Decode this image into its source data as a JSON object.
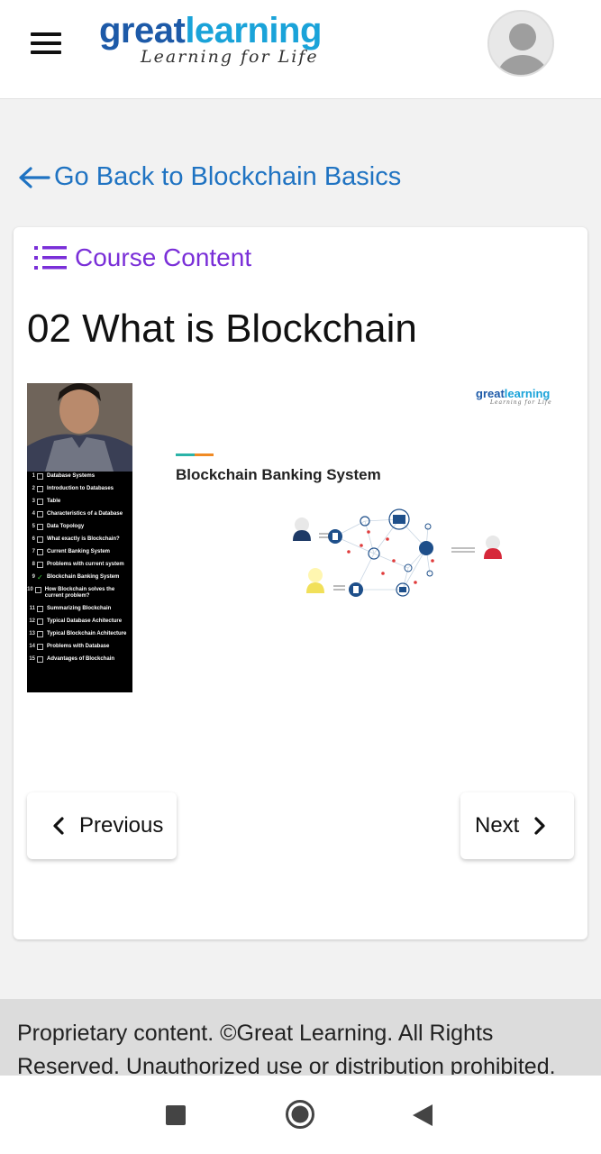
{
  "header": {
    "logo_part1": "great",
    "logo_part2": "learning",
    "logo_tagline": "Learning for Life",
    "menu_icon": "hamburger-menu-icon",
    "avatar_icon": "user-avatar-icon"
  },
  "navigation": {
    "go_back_label": "Go Back to Blockchain Basics"
  },
  "card": {
    "course_content_label": "Course Content",
    "lesson_title": "02 What is Blockchain"
  },
  "video": {
    "toc": [
      {
        "num": "1",
        "label": "Database Systems",
        "checked": false
      },
      {
        "num": "2",
        "label": "Introduction to Databases",
        "checked": false
      },
      {
        "num": "3",
        "label": "Table",
        "checked": false
      },
      {
        "num": "4",
        "label": "Characteristics of a Database",
        "checked": false
      },
      {
        "num": "5",
        "label": "Data Topology",
        "checked": false
      },
      {
        "num": "6",
        "label": "What exactly is Blockchain?",
        "checked": false
      },
      {
        "num": "7",
        "label": "Current Banking System",
        "checked": false
      },
      {
        "num": "8",
        "label": "Problems with current system",
        "checked": false
      },
      {
        "num": "9",
        "label": "Blockchain Banking System",
        "checked": true
      },
      {
        "num": "10",
        "label": "How Blockchain solves the current problem?",
        "checked": false
      },
      {
        "num": "11",
        "label": "Summarizing Blockchain",
        "checked": false
      },
      {
        "num": "12",
        "label": "Typical Database Achitecture",
        "checked": false
      },
      {
        "num": "13",
        "label": "Typical Blockchain Achitecture",
        "checked": false
      },
      {
        "num": "14",
        "label": "Problems with Database",
        "checked": false
      },
      {
        "num": "15",
        "label": "Advantages of Blockchain",
        "checked": false
      }
    ],
    "slide_logo_part1": "great",
    "slide_logo_part2": "learning",
    "slide_logo_tagline": "Learning for Life",
    "slide_title": "Blockchain Banking System"
  },
  "buttons": {
    "previous_label": "Previous",
    "next_label": "Next"
  },
  "footer": {
    "text": "Proprietary content. ©Great Learning. All Rights Reserved. Unauthorized use or distribution prohibited."
  },
  "colors": {
    "link_blue": "#1f73c2",
    "course_purple": "#7a2fd8",
    "logo_dark_blue": "#1d5aa8",
    "logo_light_blue": "#1aa3d9"
  }
}
